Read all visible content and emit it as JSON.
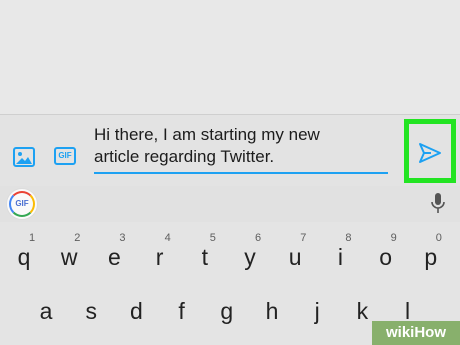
{
  "compose": {
    "text_line1": "Hi there, I am starting my new",
    "text_line2": "article regarding Twitter.",
    "image_icon": "image-icon",
    "gif_icon_label": "GIF",
    "send_icon": "send-icon",
    "highlight_color": "#22e422",
    "accent_color": "#1da1f2"
  },
  "suggestions": {
    "gif_button_label": "GIF",
    "mic_icon": "mic-icon"
  },
  "keyboard": {
    "row1": [
      {
        "letter": "q",
        "hint": "1"
      },
      {
        "letter": "w",
        "hint": "2"
      },
      {
        "letter": "e",
        "hint": "3"
      },
      {
        "letter": "r",
        "hint": "4"
      },
      {
        "letter": "t",
        "hint": "5"
      },
      {
        "letter": "y",
        "hint": "6"
      },
      {
        "letter": "u",
        "hint": "7"
      },
      {
        "letter": "i",
        "hint": "8"
      },
      {
        "letter": "o",
        "hint": "9"
      },
      {
        "letter": "p",
        "hint": "0"
      }
    ],
    "row2": [
      {
        "letter": "a"
      },
      {
        "letter": "s"
      },
      {
        "letter": "d"
      },
      {
        "letter": "f"
      },
      {
        "letter": "g"
      },
      {
        "letter": "h"
      },
      {
        "letter": "j"
      },
      {
        "letter": "k"
      },
      {
        "letter": "l"
      }
    ]
  },
  "watermark": {
    "text": "wikiHow"
  }
}
